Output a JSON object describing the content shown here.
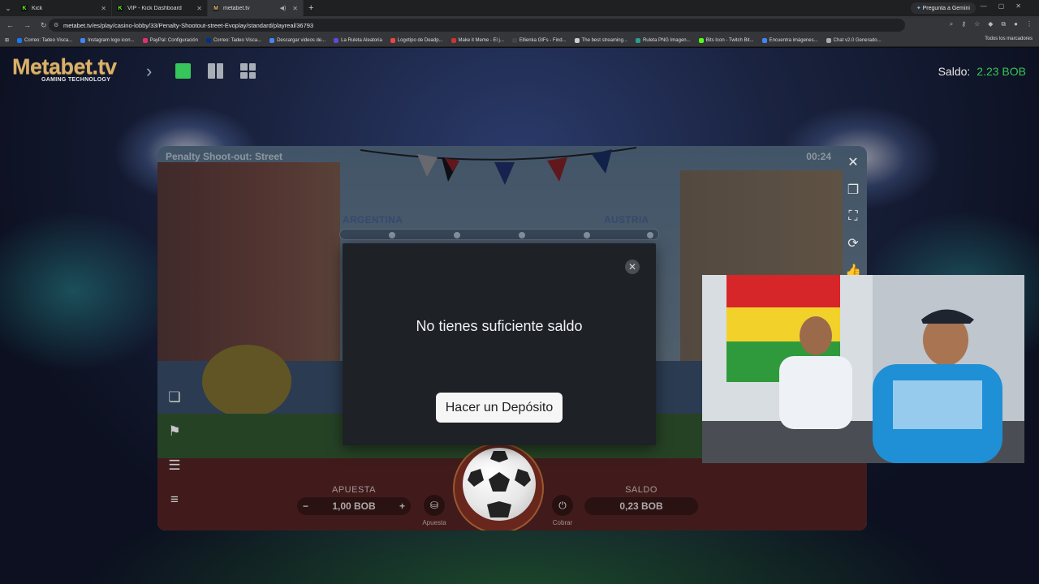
{
  "browser": {
    "tabs": [
      {
        "title": "Kick",
        "favicon_color": "#53fc18",
        "favicon_glyph": "K",
        "active": false
      },
      {
        "title": "VIP - Kick Dashboard",
        "favicon_color": "#53fc18",
        "favicon_glyph": "K",
        "active": false
      },
      {
        "title": "metabet.tv",
        "favicon_color": "#d9b16a",
        "favicon_glyph": "M",
        "active": true
      }
    ],
    "url": "metabet.tv/es/play/casino-lobby/33/Penalty-Shootout-street-Evoplay/standard/playreal/36793",
    "gemini_label": "Pregunta a Gemini",
    "bookmarks": [
      "Correo: Tadeo Visca...",
      "Instagram logo icon...",
      "PayPal: Configuración",
      "Correo: Tadeo Visca...",
      "Descargar videos de...",
      "La Ruleta Aleatoria",
      "Logotipo de Deadp...",
      "Make it Meme - El j...",
      "Ellienka GIFs - Find...",
      "The best streaming...",
      "Ruleta PNG Imagen...",
      "Bits Icon - Twitch Bit...",
      "Encuentra imágenes...",
      "Chat v2.0 Generado..."
    ],
    "all_bookmarks_label": "Todos los marcadores"
  },
  "site": {
    "logo_text": "Metabet.tv",
    "logo_subtitle": "GAMING TECHNOLOGY",
    "balance_label": "Saldo:",
    "balance_value": "2.23 BOB",
    "accent_color": "#36c659"
  },
  "game": {
    "title": "Penalty Shoot-out: Street",
    "timer": "00:24",
    "team_left": "ARGENTINA",
    "team_right": "AUSTRIA",
    "bet_label": "APUESTA",
    "bet_value": "1,00 BOB",
    "bet_minus": "−",
    "bet_plus": "+",
    "balance_label": "SALDO",
    "balance_value": "0,23 BOB",
    "chip_label": "Apuesta",
    "cashout_label": "Cobrar"
  },
  "modal": {
    "message": "No tienes suficiente saldo",
    "deposit_button": "Hacer un Depósito",
    "close_glyph": "✕"
  }
}
